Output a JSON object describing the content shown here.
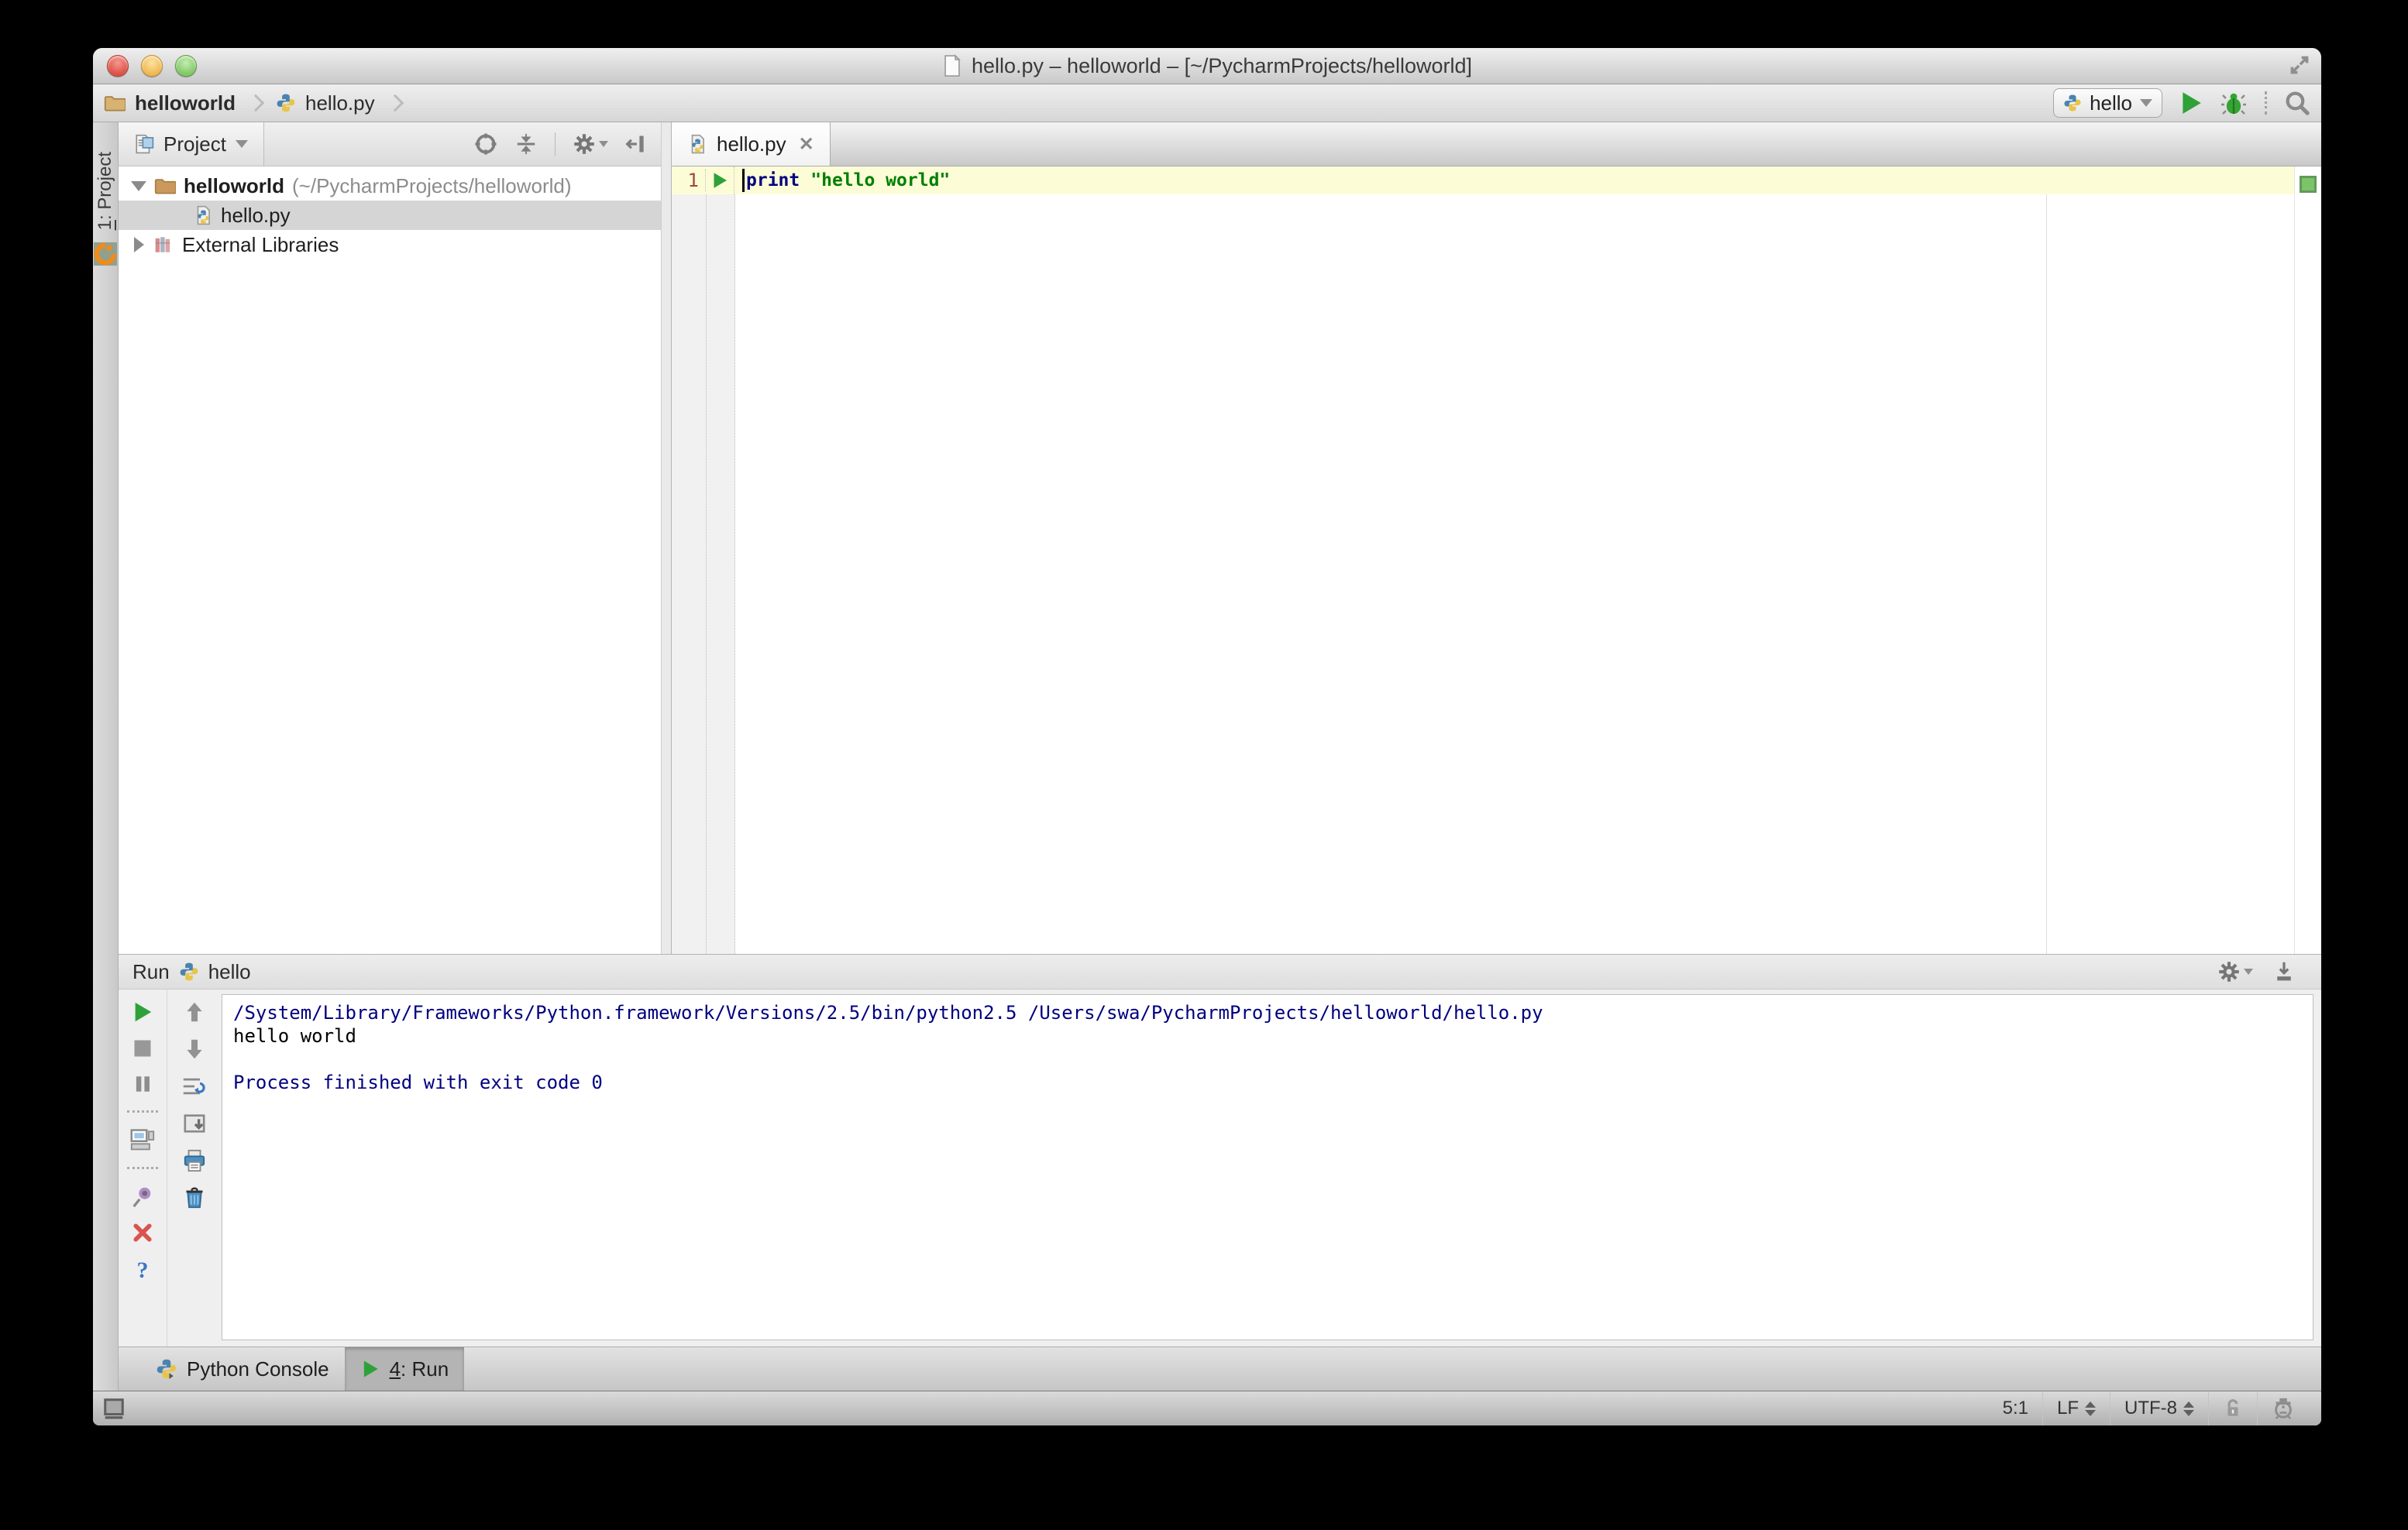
{
  "window": {
    "title": "hello.py – helloworld – [~/PycharmProjects/helloworld]"
  },
  "navbar": {
    "breadcrumbs": [
      {
        "label": "helloworld"
      },
      {
        "label": "hello.py"
      }
    ],
    "run_config": "hello"
  },
  "stripe": {
    "project_num": "1",
    "project_rest": ": Project"
  },
  "project_panel": {
    "header_label": "Project",
    "tree": [
      {
        "name": "helloworld",
        "path": "(~/PycharmProjects/helloworld)"
      },
      {
        "name": "hello.py"
      },
      {
        "name": "External Libraries"
      }
    ]
  },
  "editor": {
    "tab_label": "hello.py",
    "line_number": "1",
    "code_keyword": "print",
    "code_string": "\"hello world\""
  },
  "run_panel": {
    "title": "Run",
    "config_name": "hello",
    "console_lines": [
      {
        "text": "/System/Library/Frameworks/Python.framework/Versions/2.5/bin/python2.5 /Users/swa/PycharmProjects/helloworld/hello.py"
      },
      {
        "text": "hello world"
      },
      {
        "text": ""
      },
      {
        "text": "Process finished with exit code 0"
      }
    ]
  },
  "toolwindow_bar": {
    "python_console_label": "Python Console",
    "run_tab_num": "4",
    "run_tab_rest": ": Run"
  },
  "status_bar": {
    "caret_position": "5:1",
    "line_separator": "LF",
    "encoding": "UTF-8"
  },
  "colors": {
    "accent_run_green": "#2FA139",
    "keyword_blue": "#000080",
    "string_green": "#008000",
    "console_system_blue": "#000080",
    "current_line_highlight": "#FCFCD7",
    "tree_selection_gray": "#D5D5D5",
    "inspection_indicator_green": "#7CC36A"
  },
  "icons": {
    "close_window": "red circle",
    "minimize_window": "yellow circle",
    "zoom_window": "green circle",
    "document": "page with folded corner",
    "resize_grip": "diagonal arrows",
    "folder": "tan folder",
    "python": "python logo",
    "breadcrumb_chevron": "›",
    "run": "green play triangle",
    "debug": "green bug",
    "search": "magnifier",
    "project_view": "file with blue panel",
    "dropdown": "▾",
    "locate": "crosshair circle",
    "collapse_all": "arrows to line",
    "settings": "gear",
    "hide_panel": "bar with left arrow",
    "disclosure_open": "▼",
    "disclosure_closed": "▶",
    "external_libraries": "book stack",
    "tab_close": "✕",
    "inspection_status": "green square",
    "rerun": "green play",
    "stop": "gray square",
    "pause": "two bars",
    "restore_layout": "monitor",
    "pin": "purple pushpin",
    "close_panel": "red x",
    "help": "blue question mark",
    "prev": "gray up arrow",
    "next": "gray down arrow",
    "soft_wraps": "wrapped lines with blue arrows",
    "scroll_to_end": "box with down arrow",
    "print": "printer",
    "clear_all": "trash can",
    "toolwindow_toggle": "square with bar",
    "lock": "open padlock",
    "inspections_profile": "hector face",
    "updown_spinner": "stacked triangles"
  }
}
